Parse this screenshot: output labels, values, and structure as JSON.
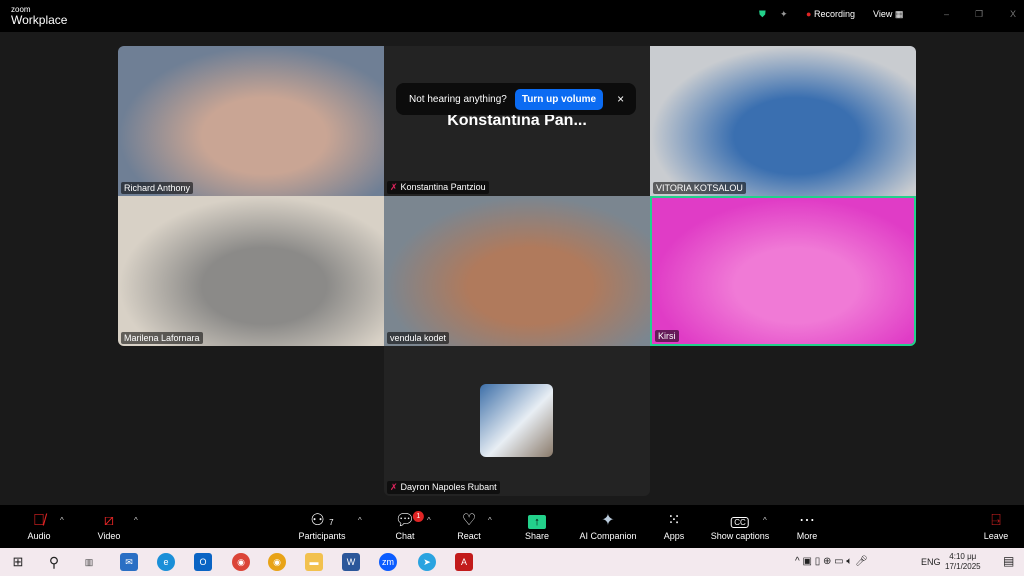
{
  "titlebar": {
    "brand_small": "zoom",
    "brand": "Workplace",
    "recording": "Recording",
    "view": "View",
    "minimize": "–",
    "restore": "❐",
    "close": "X"
  },
  "notice": {
    "text": "Not hearing anything?",
    "button": "Turn up volume",
    "close": "×"
  },
  "participants": [
    {
      "name": "Richard Anthony",
      "muted": false,
      "colors": [
        "#6f7f95",
        "#c9a594"
      ]
    },
    {
      "name": "Konstantina Pantziou",
      "muted": true,
      "display": "Konstantina  Pan...",
      "video": false
    },
    {
      "name": "VITORIA KOTSALOU",
      "muted": false,
      "colors": [
        "#c9ccd0",
        "#3a6fb0"
      ]
    },
    {
      "name": "Marilena Lafornara",
      "muted": false,
      "colors": [
        "#d8d1c6",
        "#8b8a88"
      ]
    },
    {
      "name": "vendula kodet",
      "muted": false,
      "colors": [
        "#7b8690",
        "#b07a5c"
      ]
    },
    {
      "name": "Kirsi",
      "muted": false,
      "active": true,
      "colors": [
        "#e03cc6",
        "#f07ad6"
      ]
    },
    {
      "name": "Dayron Napoles Rubant",
      "muted": true,
      "video": false
    }
  ],
  "toolbar": {
    "audio": "Audio",
    "video": "Video",
    "participants": "Participants",
    "participants_count": "7",
    "chat": "Chat",
    "chat_badge": "1",
    "react": "React",
    "share": "Share",
    "ai": "AI Companion",
    "apps": "Apps",
    "captions": "Show captions",
    "more": "More",
    "leave": "Leave"
  },
  "taskbar": {
    "lang": "ENG",
    "time": "4:10 μμ",
    "date": "17/1/2025"
  },
  "colors": {
    "accent": "#0b6bf2",
    "active_border": "#23d18b",
    "share": "#23d18b"
  }
}
